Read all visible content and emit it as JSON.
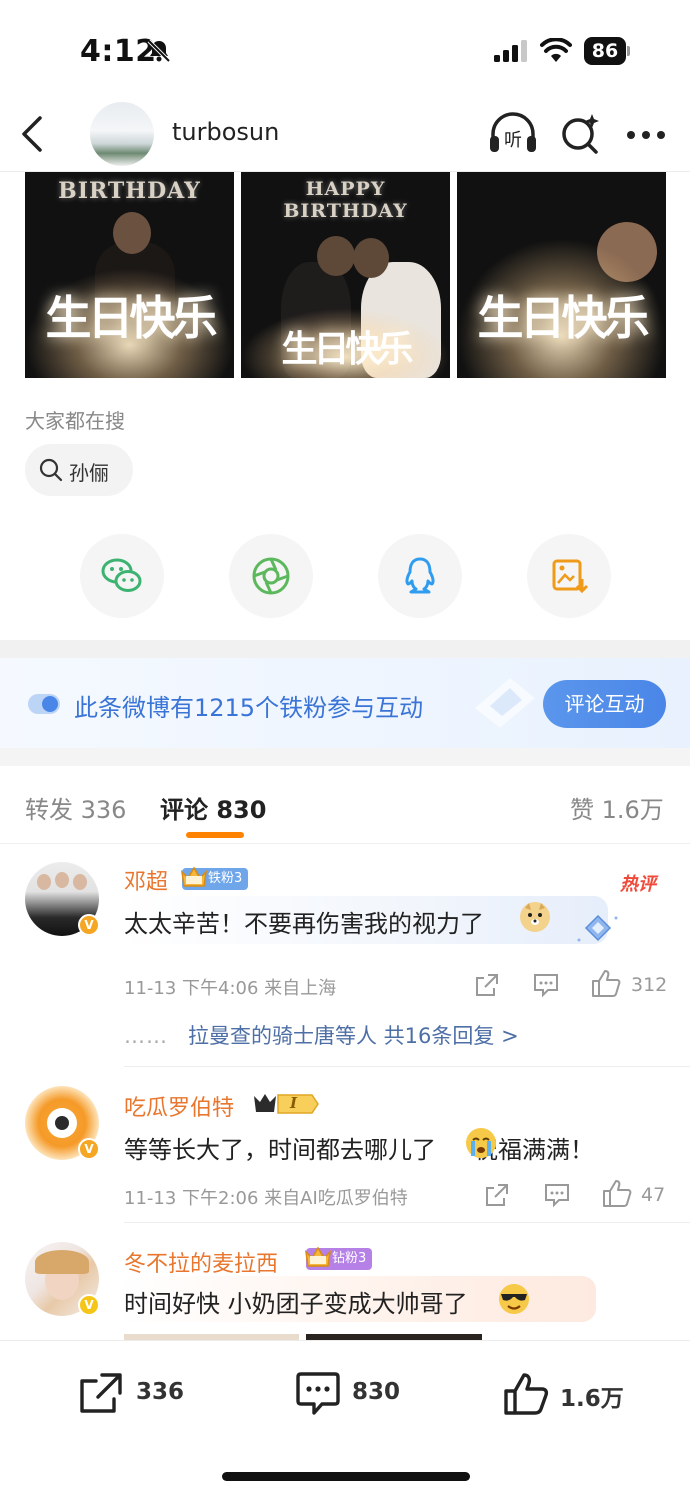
{
  "status_bar": {
    "time": "4:12",
    "battery": "86"
  },
  "nav": {
    "username": "turbosun",
    "listen_label": "听"
  },
  "photos": [
    {
      "top_text": "BIRTHDAY",
      "cake_text": "生日快乐"
    },
    {
      "top_text": "HAPPY BIRTHDAY",
      "cake_text": "生日快乐"
    },
    {
      "top_text": "",
      "cake_text": "生日快乐"
    }
  ],
  "search": {
    "title": "大家都在搜",
    "chip": "孙俪"
  },
  "banner": {
    "text": "此条微博有1215个铁粉参与互动",
    "button": "评论互动"
  },
  "tabs": {
    "repost": "转发 336",
    "comment": "评论 830",
    "like": "赞 1.6万"
  },
  "hot_tag": "热评",
  "comments": [
    {
      "name": "邓超",
      "badge": "铁粉3",
      "text": "太太辛苦！不要再伤害我的视力了",
      "meta": "11-13  下午4:06  来自上海",
      "likes": "312",
      "replies_dots": "……",
      "replies": "拉曼查的骑士唐等人  共16条回复 >"
    },
    {
      "name": "吃瓜罗伯特",
      "badge": "I",
      "text": "等等长大了，时间都去哪儿了",
      "text2": "祝福满满！",
      "meta": "11-13  下午2:06  来自AI吃瓜罗伯特",
      "likes": "47"
    },
    {
      "name": "冬不拉的麦拉西",
      "badge": "钻粉3",
      "text": "时间好快 小奶团子变成大帅哥了"
    }
  ],
  "bottom_bar": {
    "repost": "336",
    "comment": "830",
    "like": "1.6万"
  },
  "colors": {
    "accent": "#ff8200",
    "name": "#e8762e",
    "link": "#4d6fa6",
    "banner_blue": "#3a74d6"
  }
}
